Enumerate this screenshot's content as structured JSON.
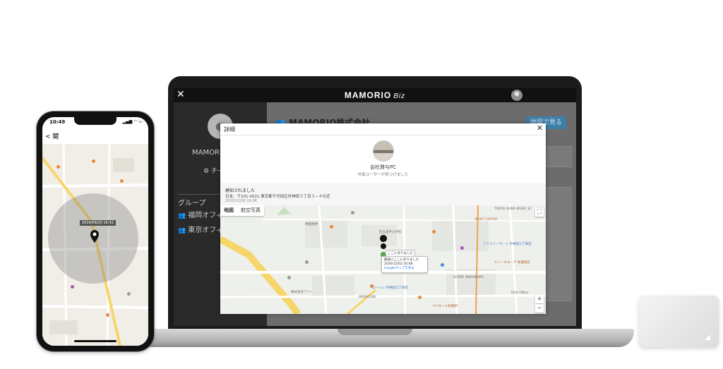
{
  "laptop": {
    "header": {
      "close_icon": "close-icon",
      "logo": "MAMORIO",
      "logo_suffix": "Biz"
    },
    "sidebar": {
      "org_name": "MAMORIO",
      "team_label": "チー",
      "group_title": "グループ",
      "groups": [
        "福岡オフィ",
        "東京オフィ"
      ]
    },
    "main": {
      "title": "MAMORIO株式会社",
      "map_button": "地図で見る"
    },
    "modal": {
      "title": "詳細",
      "device_name": "会社貸与PC",
      "device_sub": "外部ユーザーが見つけました",
      "detect_title": "検知されました",
      "detect_address": "日本、〒101-0021 東京都千代田区外神田３丁目３−４付近",
      "detect_time": "2020/12/02 16:06",
      "map": {
        "tab_map": "地図",
        "tab_satellite": "航空写真",
        "info_here": "ここにありました",
        "info_last": "最後にここにありました",
        "info_time": "2020/12/02 16:08",
        "info_link": "Googleマップで見る",
        "labels": [
          "TOKYO AKIBA MUSIC SC",
          "VAULT COFFEE",
          "ファミリーマート 外神田三丁目店",
          "UFORE AKIHABARA",
          "ローソン 外神田三丁目店",
          "AKIBACOM",
          "ベルサール秋葉原",
          "株式会社ワゾー",
          "区立昌平小学校",
          "神田明神",
          "UDX Office",
          "ドン・キホーテ 秋葉原店"
        ]
      }
    }
  },
  "phone": {
    "time": "10:49",
    "status_icons": "▂▄▆ ◠ ▭",
    "back_label": "< 鍵",
    "pin_timestamp": "2019/09/20 16:42"
  },
  "colors": {
    "brand_blue": "#3e7fa8",
    "map_bg": "#eef0ec",
    "road_yellow": "#f6d66b",
    "poi_orange": "#e9893a"
  }
}
